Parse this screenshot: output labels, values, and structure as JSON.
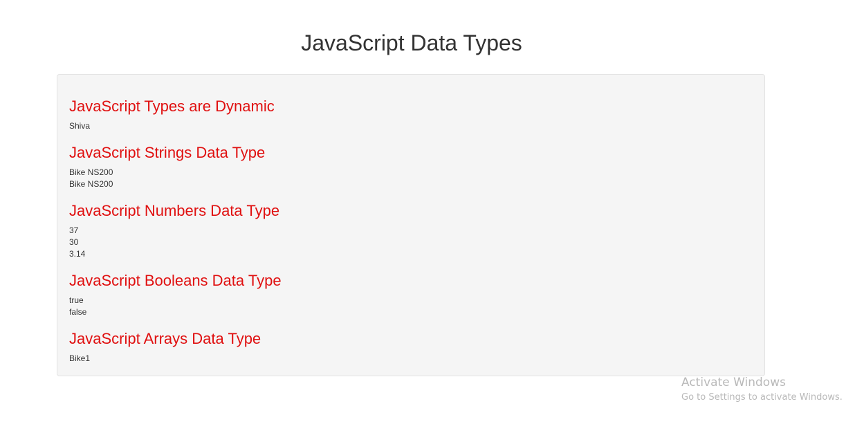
{
  "page": {
    "title": "JavaScript Data Types"
  },
  "sections": [
    {
      "title": "JavaScript Types are Dynamic",
      "values": [
        "Shiva"
      ]
    },
    {
      "title": "JavaScript Strings Data Type",
      "values": [
        "Bike NS200",
        "Bike NS200"
      ]
    },
    {
      "title": "JavaScript Numbers Data Type",
      "values": [
        "37",
        "30",
        "3.14"
      ]
    },
    {
      "title": "JavaScript Booleans Data Type",
      "values": [
        "true",
        "false"
      ]
    },
    {
      "title": "JavaScript Arrays Data Type",
      "values": [
        "Bike1"
      ]
    }
  ],
  "watermark": {
    "title": "Activate Windows",
    "subtitle": "Go to Settings to activate Windows."
  },
  "colors": {
    "heading_red": "#e01010",
    "well_background": "#f5f5f5",
    "text": "#333333"
  }
}
